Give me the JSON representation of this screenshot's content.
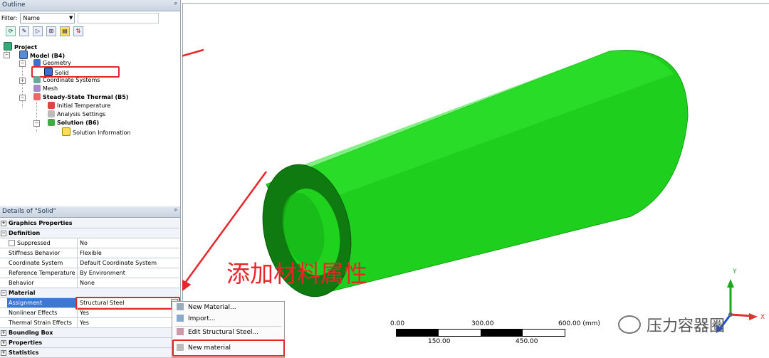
{
  "outline": {
    "title": "Outline",
    "pin": "ᵖ",
    "filter_label": "Filter:",
    "filter_value": "Name",
    "toolbar_icons": [
      "refresh-icon",
      "expand-icon",
      "collapse-icon",
      "select-icon",
      "folder-icon",
      "sort-icon"
    ],
    "tree": {
      "project": "Project",
      "model": "Model (B4)",
      "geometry": "Geometry",
      "solid": "Solid",
      "coordinate_systems": "Coordinate Systems",
      "mesh": "Mesh",
      "steady_state": "Steady-State Thermal (B5)",
      "initial_temperature": "Initial Temperature",
      "analysis_settings": "Analysis Settings",
      "solution": "Solution (B6)",
      "solution_information": "Solution Information"
    }
  },
  "details": {
    "title": "Details of \"Solid\"",
    "pin": "ᵖ",
    "rows": {
      "graphics_properties": "Graphics Properties",
      "definition": "Definition",
      "suppressed_k": "Suppressed",
      "suppressed_v": "No",
      "stiffness_k": "Stiffness Behavior",
      "stiffness_v": "Flexible",
      "coord_k": "Coordinate System",
      "coord_v": "Default Coordinate System",
      "reftemp_k": "Reference Temperature",
      "reftemp_v": "By Environment",
      "behavior_k": "Behavior",
      "behavior_v": "None",
      "material": "Material",
      "assignment_k": "Assignment",
      "assignment_v": "Structural Steel",
      "nonlinear_k": "Nonlinear Effects",
      "nonlinear_v": "Yes",
      "thermal_k": "Thermal Strain Effects",
      "thermal_v": "Yes",
      "bounding_box": "Bounding Box",
      "properties": "Properties",
      "statistics": "Statistics"
    }
  },
  "context_menu": {
    "new_material": "New Material...",
    "import": "Import...",
    "edit": "Edit Structural Steel...",
    "new_material_lower": "New material"
  },
  "annotation": "添加材料属性",
  "scale_bar": {
    "top_labels": [
      "0.00",
      "300.00",
      "600.00 (mm)"
    ],
    "bottom_labels": [
      "150.00",
      "450.00"
    ]
  },
  "triad": {
    "y": "Y",
    "x": "X"
  },
  "watermark": "压力容器圈",
  "colors": {
    "tube": "#1ed21e",
    "annotation": "#e8262a"
  }
}
